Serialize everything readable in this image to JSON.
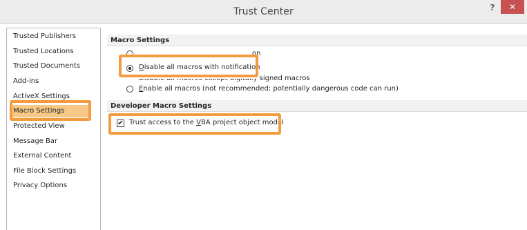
{
  "window": {
    "title": "Trust Center",
    "help_glyph": "?",
    "close_glyph": "✕"
  },
  "nav": {
    "items": [
      {
        "label": "Trusted Publishers"
      },
      {
        "label": "Trusted Locations"
      },
      {
        "label": "Trusted Documents"
      },
      {
        "label": "Add-ins"
      },
      {
        "label": "ActiveX Settings"
      },
      {
        "label": "Macro Settings",
        "selected": true
      },
      {
        "label": "Protected View"
      },
      {
        "label": "Message Bar"
      },
      {
        "label": "External Content"
      },
      {
        "label": "File Block Settings"
      },
      {
        "label": "Privacy Options"
      }
    ]
  },
  "macro_settings": {
    "header": "Macro Settings",
    "options": [
      {
        "label_visible_end": "on",
        "selected": false
      },
      {
        "label_prefix": "D",
        "label_rest": "isable all macros with notification",
        "selected": true
      },
      {
        "label": "Disable all macros except digitally signed macros",
        "selected": false
      },
      {
        "label_prefix": "E",
        "label_rest": "nable all macros (not recommended; potentially dangerous code can run)",
        "selected": false
      }
    ]
  },
  "developer_settings": {
    "header": "Developer Macro Settings",
    "trust_vba": {
      "label_before": "Trust access to the ",
      "label_accel": "V",
      "label_after": "BA project object model",
      "checked": true
    }
  },
  "colors": {
    "highlight_border": "#f59b3f",
    "nav_selected_bg": "#f7c886",
    "close_button": "#c75050"
  },
  "icons": {
    "checkmark": "✔"
  }
}
